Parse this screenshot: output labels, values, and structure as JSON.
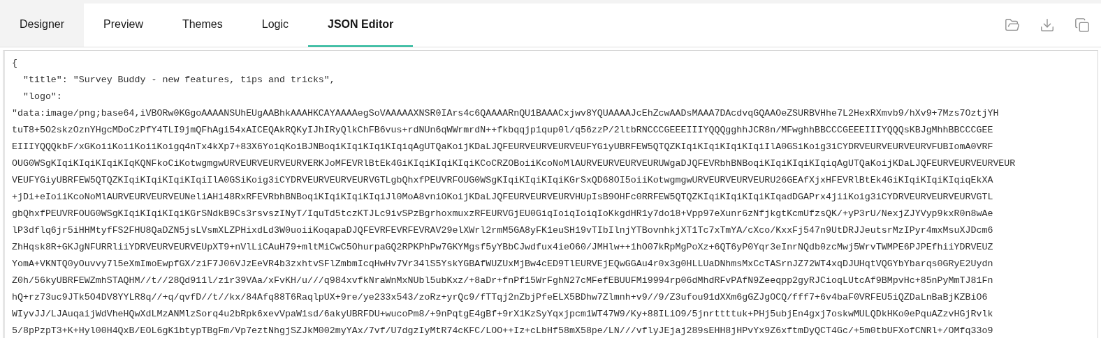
{
  "tabs": [
    {
      "label": "Designer",
      "selected": false,
      "hovered": true
    },
    {
      "label": "Preview",
      "selected": false,
      "hovered": false
    },
    {
      "label": "Themes",
      "selected": false,
      "hovered": false
    },
    {
      "label": "Logic",
      "selected": false,
      "hovered": false
    },
    {
      "label": "JSON Editor",
      "selected": true,
      "hovered": false
    }
  ],
  "toolbar": [
    {
      "kind": "open"
    },
    {
      "kind": "download"
    },
    {
      "kind": "copy"
    }
  ],
  "editor": {
    "lines": [
      "{",
      "  \"title\": \"Survey Buddy - new features, tips and tricks\",",
      "  \"logo\":",
      "\"data:image/png;base64,iVBORw0KGgoAAAANSUhEUgAABhkAAAHKCAYAAAAegSoVAAAAAXNSR0IArs4c6QAAAARnQU1BAAACxjwv8YQUAAAAJcEhZcwAADsMAAA7DAcdvqGQAAOeZSURBVHhe7L2HexRXmvb9/hXv9+7Mzs7OztjYH",
      "tuT8+5O2skzOznYHgcMDoCzPfY4TLI9jmQFhAgi54xAICEQAkRQKyIJhIRyQlkChFB6vus+rdNUn6qWWrmrdN++fkbqqjp1qup0l/q56zzP/2ltbRNCCCGEEEIIIYQQQgghhJCR8n/MFwghhBBCCCGEEEIIIYQQQsKBJgMhhBBCCCGEE",
      "EIIIYQQQkbF/xGKoiiKoiiKoiiKoigq4nTx4kXp7+83X6YoiqKoiBJNBoqiKIqiKIqiKIqiqAgUTQaKoijKDaLJQFEURVEURVEURVEUFYGiyUBRFEW5QTQZKIqiKIqiKIqiKIqiIlA0GSiKoig3iCYDRVEURVEURVEURVFUBIomA0VRF",
      "OUG0WSgKIqiKIqiKIqiKIqKQNFkoCiKotwgmgwURVEURVEURVEURVERKJoMFEVRlBtEk4GiKIqiKIqiKIqiKCoCRZOBoiiKcoNoMlAURVEURVEURVEURUWgaDJQFEVRbhBNBoqiKIqiKIqiKIqiqAgUTQaKoijKDaLJQFEURVEURVEURVEUR",
      "VEUFYGiyUBRFEW5QTQZKIqiKIqiKIqiKIqiIlA0GSiKoig3iCYDRVEURVEURVEURVGTLgbQhxfPEUVRFOUG0WSgKIqiKIqiKIqiKGrSxQD68OI5oiiKotwgmgwURVEURVEURVEURU26GEAfXjxHFEVRlBtEk4GiKIqiKIqiKIqiqEkXA",
      "+jDi+eIoiiKcoNoMlAURVEURVEURVEUNeliAH148RxRFEVRbhBNBoqiKIqiKIqiKIqiJl0MoA8vniOKoijKDaLJQFEURVEURVEURVHUpIsB9OHFc0RRFEW5QTQZKIqiKIqiKIqiKIqadDGAPrx4jiiKoig3iCYDRVEURVEURVEURVGTL",
      "gbQhxfPEUVRFOUG0WSgKIqiKIqiKIqiKGrSNdkB9Cs3rsvszINyT/IquTd5tczKTJLc9ivSPzBgrhoxmuxzRFEURVGjEU0GiqIoiqIoiqIoKkgdHR1y7do18+Vpp97eXunr6zNfjkgtKcmUfzsQK/+yP3rU/NexjZJYVyp9kxR0n8wAe",
      "lP3dflq6jr5iHHMtyfFS2FHU8QaDZN5jsLVsmXLZPHixdLd3W0uoiiKoqapaDJQFEVRFEVRFEVRAV29elXWrl2rmM5GA8yFK1euSH19vTIbIlnjYTBovnhkjXT1Tc7xTmYA/cXco/KxxFj547n9UtDRJJeutsrMzIPyr4mxMsuXJDcm6",
      "ZhHqsk8R+GKJgNFURRliiYDRVEURVEURVEUpXT9+nVlLiCAuH79+mltMiCwC5OhurpaGQ2RPKPhPw7GKYMgsf5yYBbCJwdfux4ieO60/JMHlw++1hO07kRpMgPoXz+6QT6yP0Yqr3eInrNQdb0zcMwj5WrvTWMPE6PJPEfhiiYDRVEUZ",
      "YomA+VKNTQ0yOuvvy7l5eXmImoEwpfGX/ziF7J06VJzEeVR4b3zxhtvSFlZmbmIcqHwHv7Vr34lS5YskYGBAfWUZUxMjBw4cED9TlEURVEjEQwGGAu4r0x3g0HLLUaDNhmsMxCcTASrnJZ72WT4xqDJUHqtVQGYbYbarqs0GRyE2Uydn",
      "Z0h/56kyUBRFEWZmhSTAQHM//t//28Qd911l/z1r39VAa/xFvKH/u///q984xvfkNraWnMxNUbl5ubKxz/+8aDr+fnPf15WrFghN27cMFefEBUUFMi9994rp06dMhdRFvPAfN9Zeeqpp2gyRJCioqLUtcAf9BMpvHc+85nPyMmTJ81Fn",
      "hQ+rz73uc9JTk5O4DV8YYLR8q//+q/qvfD//t//kx/84Afq88T6RaqlpUX+9re/ye233x543/zoRz+yrQc9/fTTqj2nZbjPfeELX5BDhw7Zlmnh+v9//9/Z3ufou91dXXm6gGZJgOCQ/fff7+6v4baF0VRFEU5iQZDaLnBaBjKZBiO6",
      "WIyvJJ/LJAuqaijWdVheHQwXdLMzANMlzSorq4u2bRpk6xevVpaW1sd/6akyUBRFDU+wucoPm8/+9nPqtgE4gBf+9rX1KzSyYqxjpcm1WT47W9/Ky+88ILiO9/5jnrttttuk+PHj5ubjEn4gxj7oskwMULQDkHKo0ePquAZzvHGjRvlk",
      "5/8pPzpT3+K+Hyl00H4QxB/EOL6gK1btypTBgFm/Vp7eztNhgjSZJkM002myYAx/7vf/U7dgzIyMtR74cKFC/LOO++Iz+cLbHf58mX58pe/LN///vflyJEjaj289sEHH8jHPvYx9Z6xftmDyQCT4Gc/+5m0tbUFXofCNRl+/OMfq33o9"
    ]
  }
}
